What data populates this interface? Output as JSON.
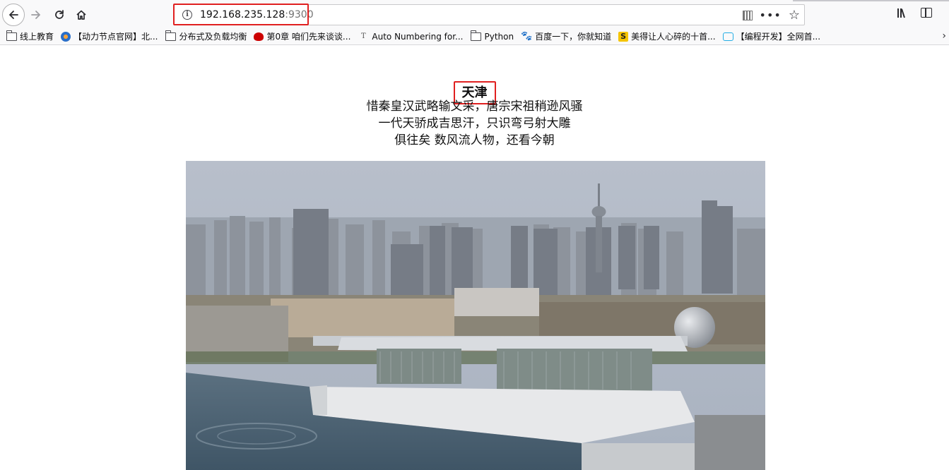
{
  "browser": {
    "url_host": "192.168.235.128",
    "url_port": ":9300"
  },
  "bookmarks": [
    {
      "label": "线上教育",
      "icon": "folder-icon"
    },
    {
      "label": "【动力节点官网】北...",
      "icon": "site-favicon"
    },
    {
      "label": "分布式及负载均衡",
      "icon": "folder-icon"
    },
    {
      "label": "第0章 咱们先来谈谈...",
      "icon": "redhat-favicon"
    },
    {
      "label": "Auto Numbering for...",
      "icon": "t-favicon"
    },
    {
      "label": "Python",
      "icon": "folder-icon"
    },
    {
      "label": "百度一下，你就知道",
      "icon": "baidu-paw-icon"
    },
    {
      "label": "美得让人心碎的十首...",
      "icon": "s-favicon"
    },
    {
      "label": "【编程开发】全网首...",
      "icon": "bilibili-icon"
    }
  ],
  "page": {
    "title": "天津",
    "poem_lines": [
      "惜秦皇汉武略输文采，唐宗宋祖稍逊风骚",
      "一代天骄成吉思汗，只识弯弓射大雕",
      "俱往矣 数风流人物，还看今朝"
    ]
  },
  "colors": {
    "highlight_box": "#e02020",
    "toolbar_bg": "#f9f9fa",
    "sky": "#aeb7c5",
    "water": "#4d6477"
  }
}
